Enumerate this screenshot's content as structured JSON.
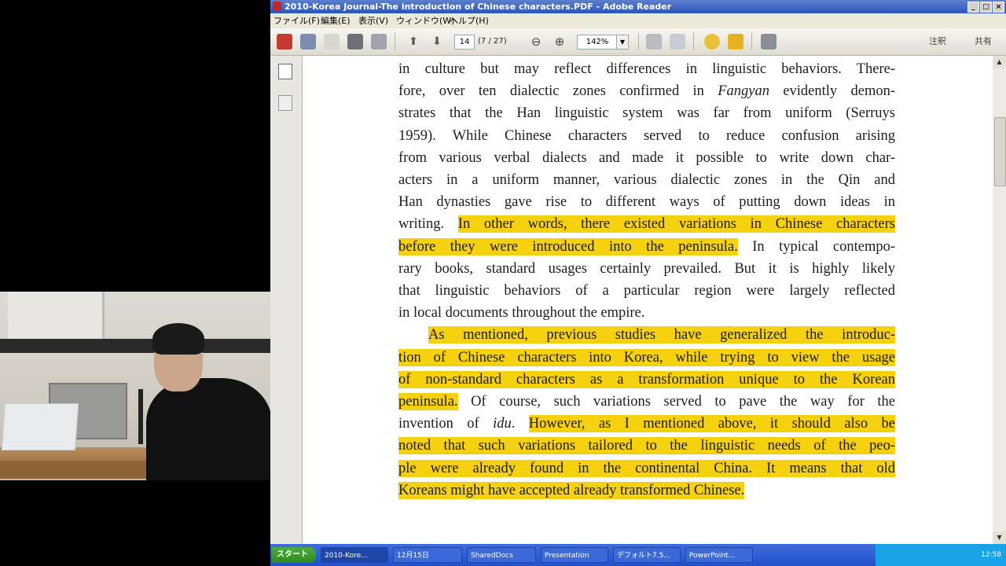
{
  "window": {
    "title": "2010-Korea Journal-The introduction of Chinese characters.PDF - Adobe Reader"
  },
  "menu": [
    "ファイル(F)",
    "編集(E)",
    "表示(V)",
    "ウィンドウ(W)",
    "ヘルプ(H)"
  ],
  "toolbar": {
    "page_value": "14",
    "page_count": "(7 / 27)",
    "zoom_value": "142%",
    "comment_label": "注釈",
    "share_label": "共有"
  },
  "document": {
    "lines": [
      {
        "segments": [
          {
            "text": "in culture but may reflect differences in linguistic behaviors. There-"
          }
        ]
      },
      {
        "segments": [
          {
            "text": "fore, over ten dialectic zones confirmed in "
          },
          {
            "text": "Fangyan",
            "italic": true
          },
          {
            "text": " evidently demon-"
          }
        ]
      },
      {
        "segments": [
          {
            "text": "strates that the Han linguistic system was far from uniform (Serruys"
          }
        ]
      },
      {
        "segments": [
          {
            "text": "1959). While Chinese characters served to reduce confusion arising"
          }
        ]
      },
      {
        "segments": [
          {
            "text": "from various verbal dialects and made it possible to write down char-"
          }
        ]
      },
      {
        "segments": [
          {
            "text": "acters in a uniform manner, various dialectic zones in the Qin and"
          }
        ]
      },
      {
        "segments": [
          {
            "text": "Han dynasties gave rise to different ways of putting down ideas in"
          }
        ]
      },
      {
        "segments": [
          {
            "text": "writing. "
          },
          {
            "text": "In other words, there existed variations in Chinese characters",
            "highlight": true
          }
        ]
      },
      {
        "segments": [
          {
            "text": "before they were introduced into the peninsula.",
            "highlight": true
          },
          {
            "text": " In typical contempo-"
          }
        ]
      },
      {
        "segments": [
          {
            "text": "rary books, standard usages certainly prevailed. But it is highly likely"
          }
        ]
      },
      {
        "segments": [
          {
            "text": "that linguistic behaviors of a particular region were largely reflected"
          }
        ]
      },
      {
        "segments": [
          {
            "text": "in local documents throughout the empire."
          }
        ],
        "last": true
      },
      {
        "segments": [
          {
            "text": "As mentioned, previous studies have generalized the introduc-",
            "highlight": true
          }
        ],
        "indent": true
      },
      {
        "segments": [
          {
            "text": "tion of Chinese characters into Korea, while trying to view the usage",
            "highlight": true
          }
        ]
      },
      {
        "segments": [
          {
            "text": "of non-standard characters as a transformation unique to the Korean",
            "highlight": true
          }
        ]
      },
      {
        "segments": [
          {
            "text": "peninsula.",
            "highlight": true
          },
          {
            "text": " Of course, such variations served to pave the way for the"
          }
        ]
      },
      {
        "segments": [
          {
            "text": "invention of "
          },
          {
            "text": "idu",
            "italic": true
          },
          {
            "text": ". "
          },
          {
            "text": "However, as I mentioned above, it should also be",
            "highlight": true
          }
        ]
      },
      {
        "segments": [
          {
            "text": "noted that such variations tailored to the linguistic needs of the peo-",
            "highlight": true
          }
        ]
      },
      {
        "segments": [
          {
            "text": "ple were already found in the continental China. It means that old",
            "highlight": true
          }
        ]
      },
      {
        "segments": [
          {
            "text": "Koreans might have accepted already transformed Chinese.",
            "highlight": true
          }
        ],
        "last": true
      }
    ]
  },
  "taskbar": {
    "start_label": "スタート",
    "tasks": [
      "2010-Kore...",
      "12月15日",
      "SharedDocs",
      "Presentation",
      "デフォルト7.5...",
      "PowerPoint..."
    ],
    "clock": "12:58"
  },
  "colors": {
    "highlight": "#f5d10f",
    "titlebar": "#2a55b8",
    "taskbar": "#2350c8"
  }
}
